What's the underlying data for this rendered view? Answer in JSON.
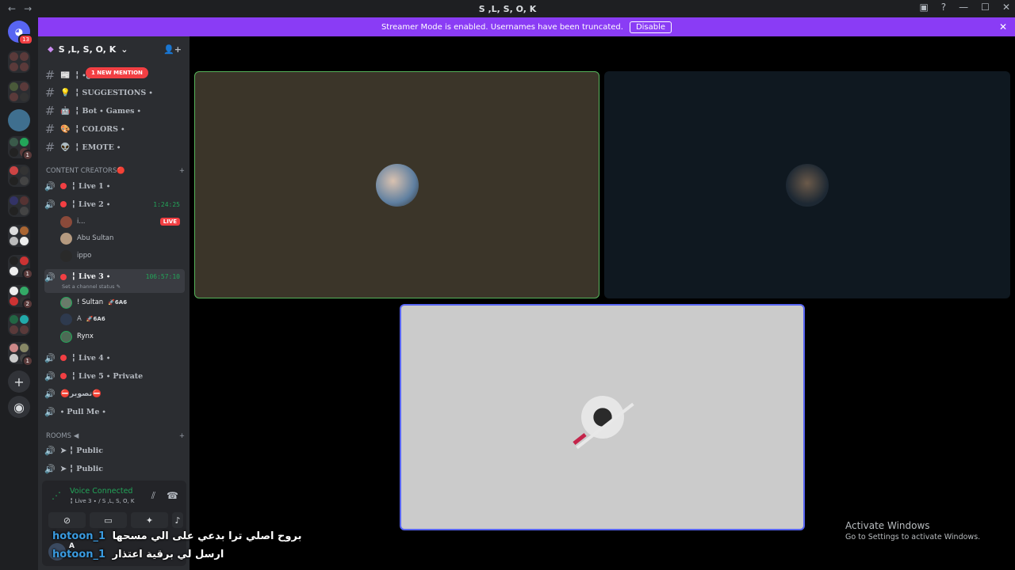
{
  "window": {
    "title": "S ,L, S, O, K",
    "back": "←",
    "forward": "→",
    "minimize": "—",
    "maximize": "☐",
    "close": "✕",
    "inbox": "▣",
    "help": "?"
  },
  "banner": {
    "text": "Streamer Mode is enabled. Usernames have been truncated.",
    "disable_label": "Disable",
    "close": "✕"
  },
  "servers": {
    "home_badge": "13",
    "badges": [
      "1",
      "1",
      "2",
      "1"
    ],
    "add": "+",
    "explore": "◉"
  },
  "guild": {
    "name": "S ,L, S, O, K",
    "chevron": "⌄",
    "invite": "👤+"
  },
  "text_channels": [
    {
      "emoji": "📰",
      "name": "╏ ∙ن"
    },
    {
      "emoji": "💡",
      "name": "╏ SUGGESTIONS ∙"
    },
    {
      "emoji": "🤖",
      "name": "╏ Bot ∙ Games ∙"
    },
    {
      "emoji": "🎨",
      "name": "╏ COLORS ∙"
    },
    {
      "emoji": "👽",
      "name": "╏ EMOTE ∙"
    }
  ],
  "mention_pill": "1 NEW MENTION",
  "categories": {
    "content": "CONTENT CREATORS🔴",
    "rooms": "ROOMS ◀",
    "plus": "+"
  },
  "voice_channels": [
    {
      "name": "╏ Live 1 ∙",
      "timer": ""
    },
    {
      "name": "╏ Live 2 ∙",
      "timer": "1:24:25"
    },
    {
      "name": "╏ Live 3 ∙",
      "timer": "106:57:10",
      "status": "Set a channel status ✎"
    },
    {
      "name": "╏ Live 4 ∙",
      "timer": ""
    },
    {
      "name": "╏ Live 5 ∙ Private",
      "timer": ""
    },
    {
      "name": "⛔تصوير⛔",
      "timer": ""
    },
    {
      "name": "∙ Pull Me ∙",
      "timer": ""
    },
    {
      "name": "➤ ╏ Public",
      "timer": ""
    },
    {
      "name": "➤ ╏ Public",
      "timer": ""
    }
  ],
  "live2_members": [
    {
      "name": "i...",
      "live": "LIVE"
    },
    {
      "name": "Abu Sultan",
      "live": ""
    },
    {
      "name": "ippo",
      "live": ""
    }
  ],
  "live3_members": [
    {
      "name": "! Sultan",
      "tag": "🚀6A6"
    },
    {
      "name": "A",
      "tag": "🚀6A6"
    },
    {
      "name": "Rynx",
      "tag": ""
    }
  ],
  "voice_panel": {
    "connected": "Voice Connected",
    "sub": "╏ Live 3 ∙  / S ,L, S, O, K",
    "btn_camera": "⊘",
    "btn_screen": "▭",
    "btn_activity": "✦",
    "btn_sound": "♪"
  },
  "user": {
    "name": "A",
    "status": "In vo..."
  },
  "overlay": {
    "line1_user": "hotoon_1",
    "line1_msg": "بروح اصلي ترا بدعي على الي مسحها",
    "line2_user": "hotoon_1",
    "line2_msg": "ارسل لي برقية اعتذار"
  },
  "activate": {
    "line1": "Activate Windows",
    "line2": "Go to Settings to activate Windows."
  },
  "colors": {
    "accent": "#8a3cf5",
    "live": "#f23f43",
    "connected": "#23a559",
    "tile1": "#3b3529",
    "tile2": "#0f1820",
    "tile3": "#cbcbcb"
  }
}
